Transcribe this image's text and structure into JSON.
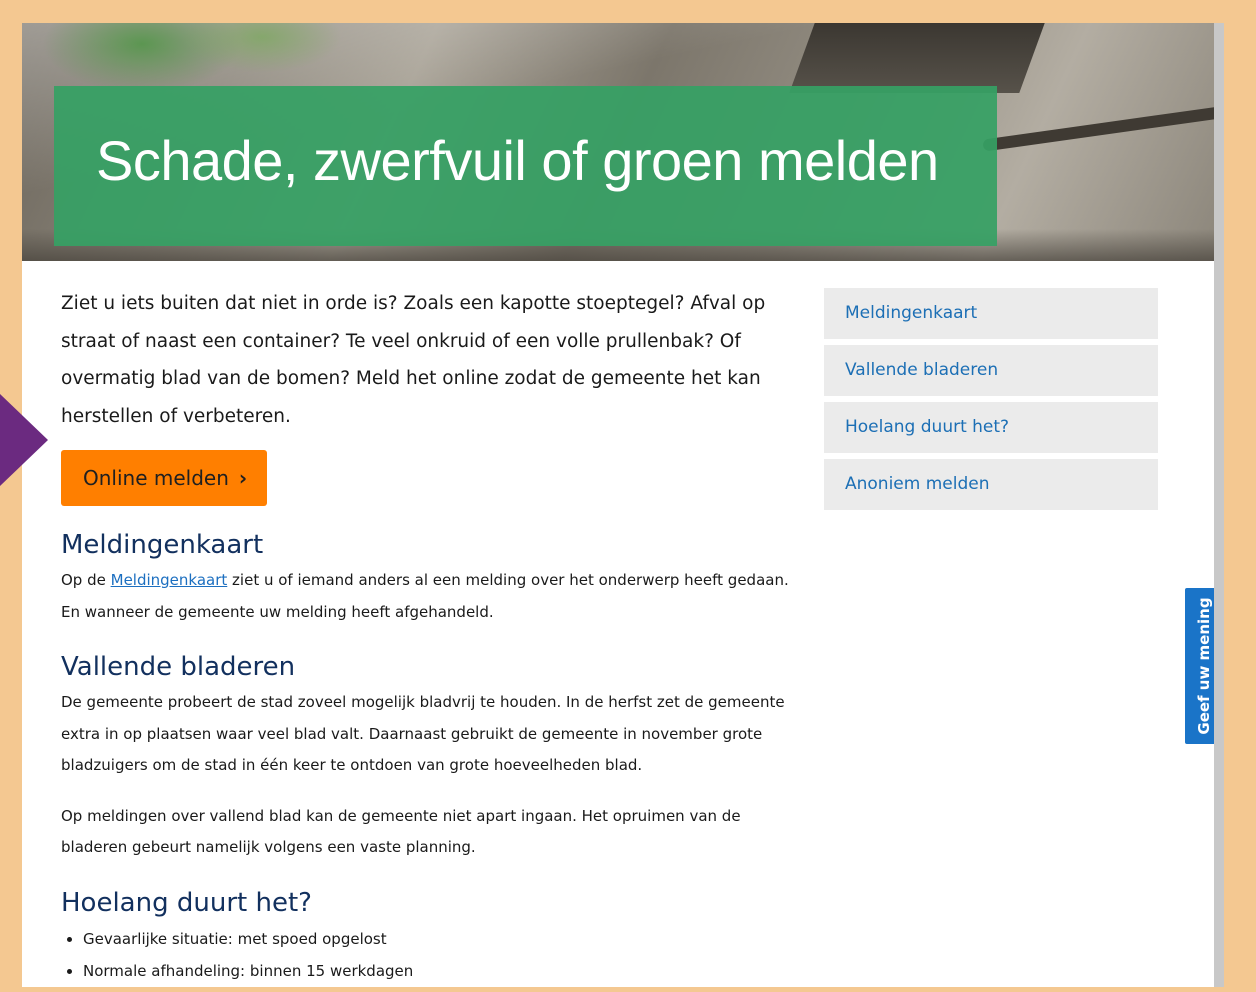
{
  "hero": {
    "title": "Schade, zwerfvuil of groen melden"
  },
  "intro": {
    "text": "Ziet u iets buiten dat niet in orde is? Zoals een kapotte stoeptegel? Afval op straat of naast een container? Te veel onkruid of een volle prullenbak? Of overmatig blad van de bomen? Meld het online zodat de gemeente het kan herstellen of verbeteren."
  },
  "report_button": {
    "label": "Online melden",
    "chevron": "›",
    "color": "#ff7f00"
  },
  "sections": {
    "map": {
      "heading": "Meldingenkaart",
      "prefix": "Op de ",
      "link": "Meldingenkaart",
      "suffix": " ziet u of iemand anders al een melding over het onderwerp heeft gedaan. En wanneer de gemeente uw melding heeft afgehandeld."
    },
    "leaves": {
      "heading": "Vallende bladeren",
      "p1": "De gemeente probeert de stad zoveel mogelijk bladvrij te houden. In de herfst zet de gemeente extra in op plaatsen waar veel blad valt. Daarnaast gebruikt de gemeente in november grote bladzuigers om de stad in één keer te ontdoen van grote hoeveelheden blad.",
      "p2": "Op meldingen over vallend blad kan de gemeente niet apart ingaan. Het opruimen van de bladeren gebeurt namelijk volgens een vaste planning."
    },
    "duration": {
      "heading": "Hoelang duurt het?",
      "items": [
        "Gevaarlijke situatie: met spoed opgelost",
        "Normale afhandeling: binnen 15 werkdagen"
      ]
    }
  },
  "sidenav": {
    "items": [
      {
        "label": "Meldingenkaart"
      },
      {
        "label": "Vallende bladeren"
      },
      {
        "label": "Hoelang duurt het?"
      },
      {
        "label": "Anoniem melden"
      }
    ]
  },
  "feedback": {
    "label": "Geef uw mening",
    "color": "#1a74c8"
  },
  "colors": {
    "frame": "#f4c891",
    "banner": "#36a064",
    "heading": "#12305e",
    "link": "#1c6fb5",
    "pointer": "#6b2a80"
  }
}
